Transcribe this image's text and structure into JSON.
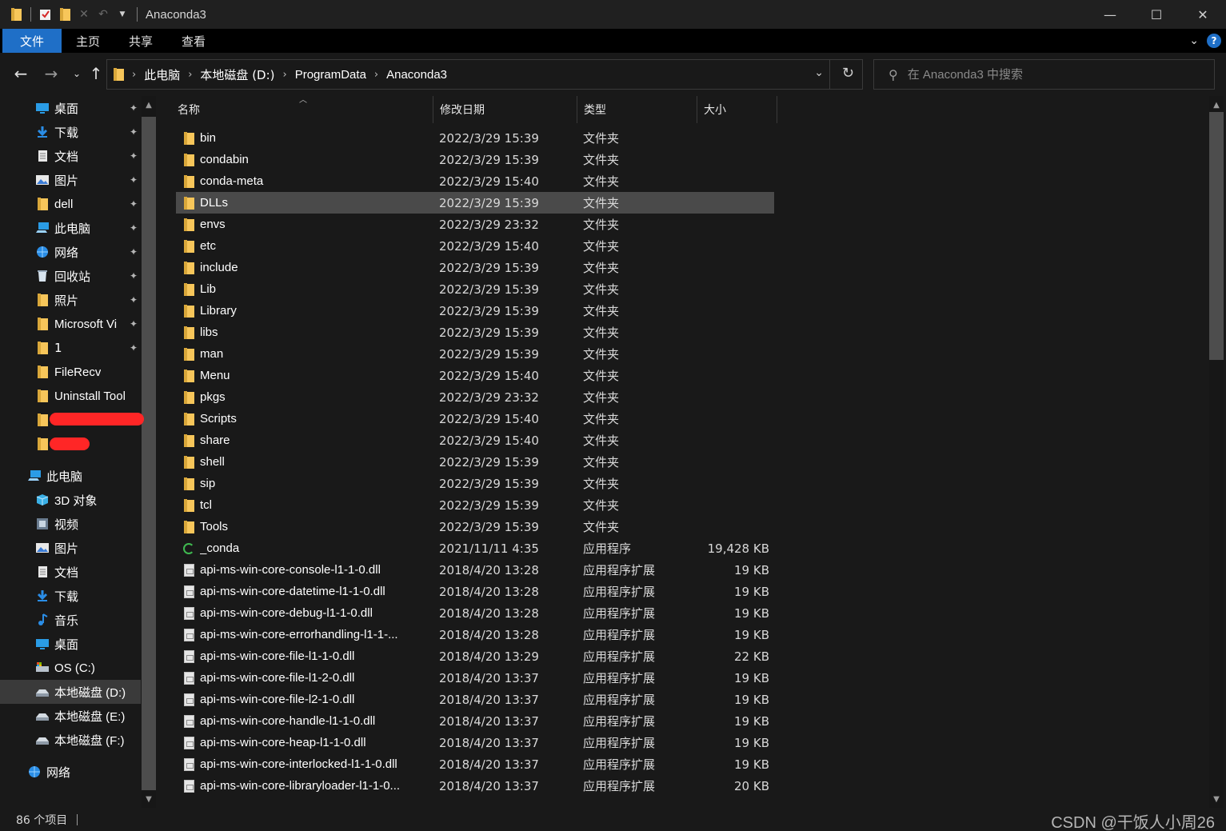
{
  "window": {
    "title": "Anaconda3",
    "minimize": "—",
    "maximize": "☐",
    "close": "✕"
  },
  "ribbon": {
    "tabs": [
      "文件",
      "主页",
      "共享",
      "查看"
    ]
  },
  "address": {
    "crumbs": [
      "此电脑",
      "本地磁盘 (D:)",
      "ProgramData",
      "Anaconda3"
    ]
  },
  "search": {
    "placeholder": "在 Anaconda3 中搜索"
  },
  "sidebar": {
    "quick_access": [
      {
        "label": "桌面",
        "icon": "desktop-icon",
        "pinned": true
      },
      {
        "label": "下载",
        "icon": "download-icon",
        "pinned": true
      },
      {
        "label": "文档",
        "icon": "document-icon",
        "pinned": true
      },
      {
        "label": "图片",
        "icon": "picture-icon",
        "pinned": true
      },
      {
        "label": "dell",
        "icon": "folder-icon",
        "pinned": true
      },
      {
        "label": "此电脑",
        "icon": "computer-icon",
        "pinned": true
      },
      {
        "label": "网络",
        "icon": "network-icon",
        "pinned": true
      },
      {
        "label": "回收站",
        "icon": "recycle-bin-icon",
        "pinned": true
      },
      {
        "label": "照片",
        "icon": "folder-icon",
        "pinned": true
      },
      {
        "label": "Microsoft Vi",
        "icon": "folder-icon",
        "pinned": true
      },
      {
        "label": "1",
        "icon": "folder-icon",
        "pinned": true
      },
      {
        "label": "FileRecv",
        "icon": "folder-icon",
        "pinned": false
      },
      {
        "label": "Uninstall Tool",
        "icon": "folder-icon",
        "pinned": false
      }
    ],
    "this_pc_label": "此电脑",
    "this_pc": [
      {
        "label": "3D 对象",
        "icon": "3d-objects-icon"
      },
      {
        "label": "视频",
        "icon": "video-icon"
      },
      {
        "label": "图片",
        "icon": "picture-icon"
      },
      {
        "label": "文档",
        "icon": "document-icon"
      },
      {
        "label": "下载",
        "icon": "download-icon"
      },
      {
        "label": "音乐",
        "icon": "music-icon"
      },
      {
        "label": "桌面",
        "icon": "desktop-icon"
      },
      {
        "label": "OS (C:)",
        "icon": "os-drive-icon"
      },
      {
        "label": "本地磁盘 (D:)",
        "icon": "drive-icon",
        "selected": true
      },
      {
        "label": "本地磁盘 (E:)",
        "icon": "drive-icon"
      },
      {
        "label": "本地磁盘 (F:)",
        "icon": "drive-icon"
      }
    ],
    "network_label": "网络"
  },
  "columns": {
    "name": "名称",
    "date": "修改日期",
    "type": "类型",
    "size": "大小"
  },
  "files": [
    {
      "name": "bin",
      "date": "2022/3/29 15:39",
      "type": "文件夹",
      "size": "",
      "kind": "folder"
    },
    {
      "name": "condabin",
      "date": "2022/3/29 15:39",
      "type": "文件夹",
      "size": "",
      "kind": "folder"
    },
    {
      "name": "conda-meta",
      "date": "2022/3/29 15:40",
      "type": "文件夹",
      "size": "",
      "kind": "folder"
    },
    {
      "name": "DLLs",
      "date": "2022/3/29 15:39",
      "type": "文件夹",
      "size": "",
      "kind": "folder",
      "selected": true
    },
    {
      "name": "envs",
      "date": "2022/3/29 23:32",
      "type": "文件夹",
      "size": "",
      "kind": "folder"
    },
    {
      "name": "etc",
      "date": "2022/3/29 15:40",
      "type": "文件夹",
      "size": "",
      "kind": "folder"
    },
    {
      "name": "include",
      "date": "2022/3/29 15:39",
      "type": "文件夹",
      "size": "",
      "kind": "folder"
    },
    {
      "name": "Lib",
      "date": "2022/3/29 15:39",
      "type": "文件夹",
      "size": "",
      "kind": "folder"
    },
    {
      "name": "Library",
      "date": "2022/3/29 15:39",
      "type": "文件夹",
      "size": "",
      "kind": "folder"
    },
    {
      "name": "libs",
      "date": "2022/3/29 15:39",
      "type": "文件夹",
      "size": "",
      "kind": "folder"
    },
    {
      "name": "man",
      "date": "2022/3/29 15:39",
      "type": "文件夹",
      "size": "",
      "kind": "folder"
    },
    {
      "name": "Menu",
      "date": "2022/3/29 15:40",
      "type": "文件夹",
      "size": "",
      "kind": "folder"
    },
    {
      "name": "pkgs",
      "date": "2022/3/29 23:32",
      "type": "文件夹",
      "size": "",
      "kind": "folder"
    },
    {
      "name": "Scripts",
      "date": "2022/3/29 15:40",
      "type": "文件夹",
      "size": "",
      "kind": "folder"
    },
    {
      "name": "share",
      "date": "2022/3/29 15:40",
      "type": "文件夹",
      "size": "",
      "kind": "folder"
    },
    {
      "name": "shell",
      "date": "2022/3/29 15:39",
      "type": "文件夹",
      "size": "",
      "kind": "folder"
    },
    {
      "name": "sip",
      "date": "2022/3/29 15:39",
      "type": "文件夹",
      "size": "",
      "kind": "folder"
    },
    {
      "name": "tcl",
      "date": "2022/3/29 15:39",
      "type": "文件夹",
      "size": "",
      "kind": "folder"
    },
    {
      "name": "Tools",
      "date": "2022/3/29 15:39",
      "type": "文件夹",
      "size": "",
      "kind": "folder"
    },
    {
      "name": "_conda",
      "date": "2021/11/11 4:35",
      "type": "应用程序",
      "size": "19,428 KB",
      "kind": "app"
    },
    {
      "name": "api-ms-win-core-console-l1-1-0.dll",
      "date": "2018/4/20 13:28",
      "type": "应用程序扩展",
      "size": "19 KB",
      "kind": "dll"
    },
    {
      "name": "api-ms-win-core-datetime-l1-1-0.dll",
      "date": "2018/4/20 13:28",
      "type": "应用程序扩展",
      "size": "19 KB",
      "kind": "dll"
    },
    {
      "name": "api-ms-win-core-debug-l1-1-0.dll",
      "date": "2018/4/20 13:28",
      "type": "应用程序扩展",
      "size": "19 KB",
      "kind": "dll"
    },
    {
      "name": "api-ms-win-core-errorhandling-l1-1-...",
      "date": "2018/4/20 13:28",
      "type": "应用程序扩展",
      "size": "19 KB",
      "kind": "dll"
    },
    {
      "name": "api-ms-win-core-file-l1-1-0.dll",
      "date": "2018/4/20 13:29",
      "type": "应用程序扩展",
      "size": "22 KB",
      "kind": "dll"
    },
    {
      "name": "api-ms-win-core-file-l1-2-0.dll",
      "date": "2018/4/20 13:37",
      "type": "应用程序扩展",
      "size": "19 KB",
      "kind": "dll"
    },
    {
      "name": "api-ms-win-core-file-l2-1-0.dll",
      "date": "2018/4/20 13:37",
      "type": "应用程序扩展",
      "size": "19 KB",
      "kind": "dll"
    },
    {
      "name": "api-ms-win-core-handle-l1-1-0.dll",
      "date": "2018/4/20 13:37",
      "type": "应用程序扩展",
      "size": "19 KB",
      "kind": "dll"
    },
    {
      "name": "api-ms-win-core-heap-l1-1-0.dll",
      "date": "2018/4/20 13:37",
      "type": "应用程序扩展",
      "size": "19 KB",
      "kind": "dll"
    },
    {
      "name": "api-ms-win-core-interlocked-l1-1-0.dll",
      "date": "2018/4/20 13:37",
      "type": "应用程序扩展",
      "size": "19 KB",
      "kind": "dll"
    },
    {
      "name": "api-ms-win-core-libraryloader-l1-1-0...",
      "date": "2018/4/20 13:37",
      "type": "应用程序扩展",
      "size": "20 KB",
      "kind": "dll"
    }
  ],
  "status": {
    "count": "86 个项目"
  },
  "watermark": "CSDN @干饭人小周26"
}
